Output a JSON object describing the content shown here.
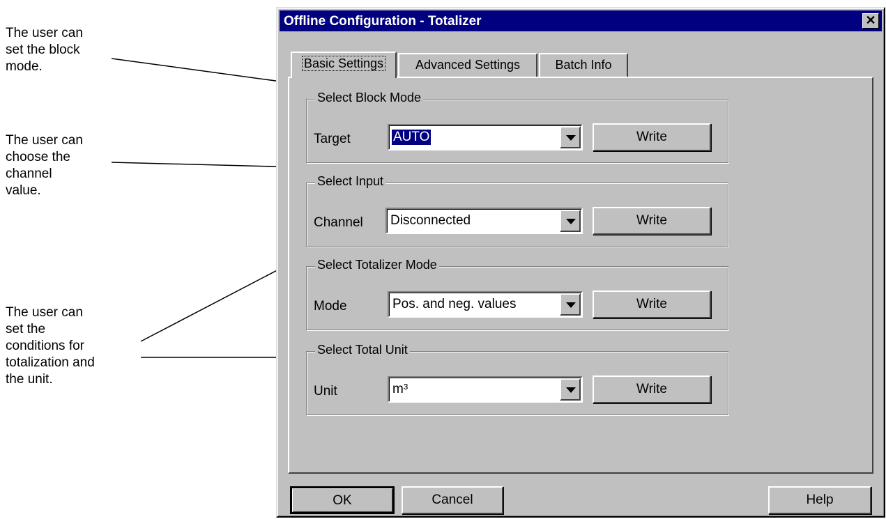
{
  "annotations": {
    "block_mode": [
      "The user can",
      "set the block",
      "mode."
    ],
    "channel": [
      "The user can",
      "choose the",
      "channel",
      "value."
    ],
    "totalizer": [
      "The user can",
      "set the",
      "conditions for",
      "totalization and",
      "the unit."
    ]
  },
  "window": {
    "title": "Offline Configuration - Totalizer",
    "close_glyph": "✕"
  },
  "tabs": [
    {
      "label": "Basic Settings",
      "active": true
    },
    {
      "label": "Advanced Settings",
      "active": false
    },
    {
      "label": "Batch Info",
      "active": false
    }
  ],
  "groups": {
    "block_mode": {
      "title": "Select Block Mode",
      "field_label": "Target",
      "value": "AUTO",
      "write_label": "Write"
    },
    "input": {
      "title": "Select Input",
      "field_label": "Channel",
      "value": "Disconnected",
      "write_label": "Write"
    },
    "totalizer_mode": {
      "title": "Select Totalizer Mode",
      "field_label": "Mode",
      "value": "Pos. and neg. values",
      "write_label": "Write"
    },
    "total_unit": {
      "title": "Select Total Unit",
      "field_label": "Unit",
      "value": "m³",
      "write_label": "Write"
    }
  },
  "footer": {
    "ok_label": "OK",
    "cancel_label": "Cancel",
    "help_label": "Help"
  },
  "colors": {
    "title_bar": "#000080",
    "face": "#c0c0c0",
    "selection": "#000080"
  }
}
